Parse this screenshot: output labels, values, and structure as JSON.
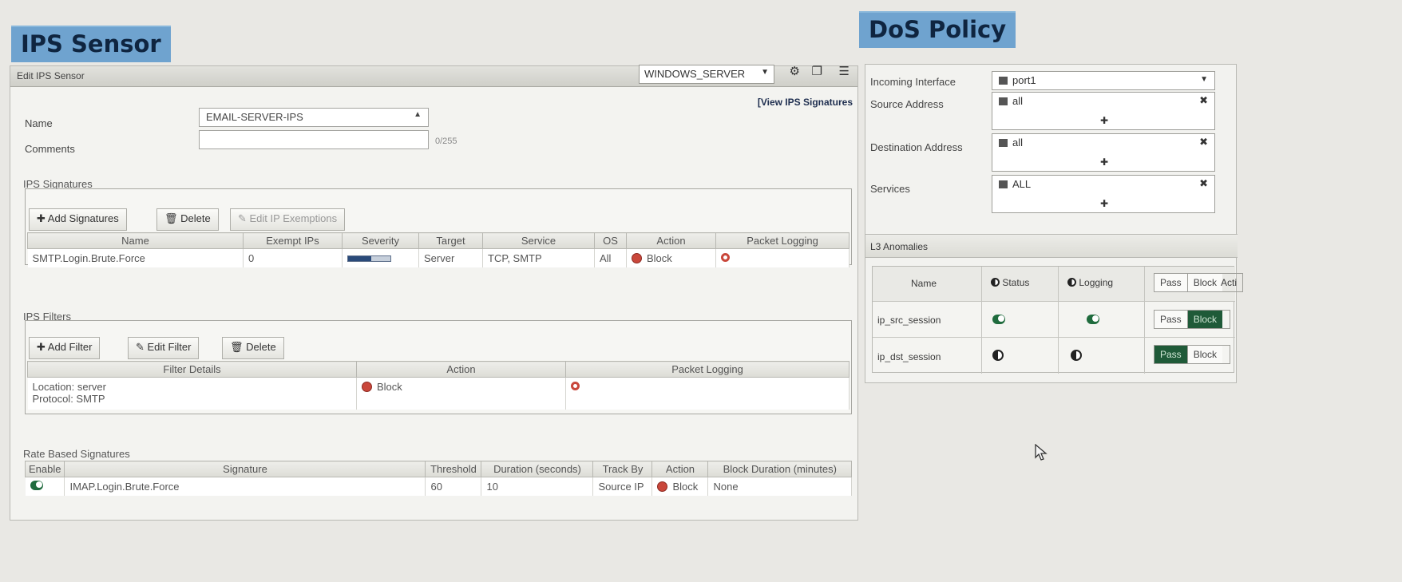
{
  "ips_title": "IPS Sensor",
  "dos_title": "DoS Policy",
  "ips": {
    "panel_title": "Edit IPS Sensor",
    "profile_value": "WINDOWS_SERVER",
    "name_label": "Name",
    "name_value": "EMAIL-SERVER-IPS",
    "comments_label": "Comments",
    "comments_count": "0/255",
    "view_link": "[View IPS Signatures",
    "signatures": {
      "title": "IPS Signatures",
      "add_label": "Add Signatures",
      "delete_label": "Delete",
      "exemptions_label": "Edit IP Exemptions",
      "headers": [
        "Name",
        "Exempt IPs",
        "Severity",
        "Target",
        "Service",
        "OS",
        "Action",
        "Packet Logging"
      ],
      "rows": [
        {
          "name": "SMTP.Login.Brute.Force",
          "exempt": "0",
          "target": "Server",
          "service": "TCP, SMTP",
          "os": "All",
          "action": "Block"
        }
      ]
    },
    "filters": {
      "title": "IPS Filters",
      "add_label": "Add Filter",
      "edit_label": "Edit Filter",
      "delete_label": "Delete",
      "headers": [
        "Filter Details",
        "Action",
        "Packet Logging"
      ],
      "rows": [
        {
          "location": "Location: server",
          "protocol": "Protocol: SMTP",
          "action": "Block"
        }
      ]
    },
    "rate": {
      "title": "Rate Based Signatures",
      "headers": [
        "Enable",
        "Signature",
        "Threshold",
        "Duration (seconds)",
        "Track By",
        "Action",
        "Block Duration (minutes)"
      ],
      "rows": [
        {
          "signature": "IMAP.Login.Brute.Force",
          "threshold": "60",
          "duration": "10",
          "track_by": "Source IP",
          "action": "Block",
          "block_duration": "None"
        }
      ]
    }
  },
  "dos": {
    "incoming_label": "Incoming Interface",
    "incoming_value": "port1",
    "source_label": "Source Address",
    "source_value": "all",
    "dest_label": "Destination Address",
    "dest_value": "all",
    "services_label": "Services",
    "services_value": "ALL",
    "anomalies_title": "L3 Anomalies",
    "headers": {
      "name": "Name",
      "status": "Status",
      "logging": "Logging",
      "pass": "Pass",
      "block": "Block",
      "action": "Acti"
    },
    "rows": [
      {
        "name": "ip_src_session",
        "status": "on",
        "logging": "on",
        "action": "Block",
        "pass": "Pass",
        "block": "Block"
      },
      {
        "name": "ip_dst_session",
        "status": "off",
        "logging": "off",
        "action": "Pass",
        "pass": "Pass",
        "block": "Block"
      }
    ]
  }
}
